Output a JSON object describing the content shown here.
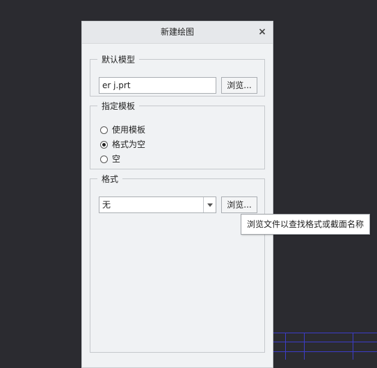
{
  "dialog": {
    "title": "新建绘图",
    "close_glyph": "×",
    "default_model": {
      "legend": "默认模型",
      "value": "er j.prt",
      "browse_label": "浏览..."
    },
    "template": {
      "legend": "指定模板",
      "options": [
        {
          "label": "使用模板",
          "selected": false
        },
        {
          "label": "格式为空",
          "selected": true
        },
        {
          "label": "空",
          "selected": false
        }
      ]
    },
    "format": {
      "legend": "格式",
      "value": "无",
      "browse_label": "浏览..."
    }
  },
  "tooltip": {
    "text": "浏览文件以查找格式或截面名称"
  },
  "colors": {
    "background": "#2b2b30",
    "grid_lines": "#3c3cc8"
  }
}
